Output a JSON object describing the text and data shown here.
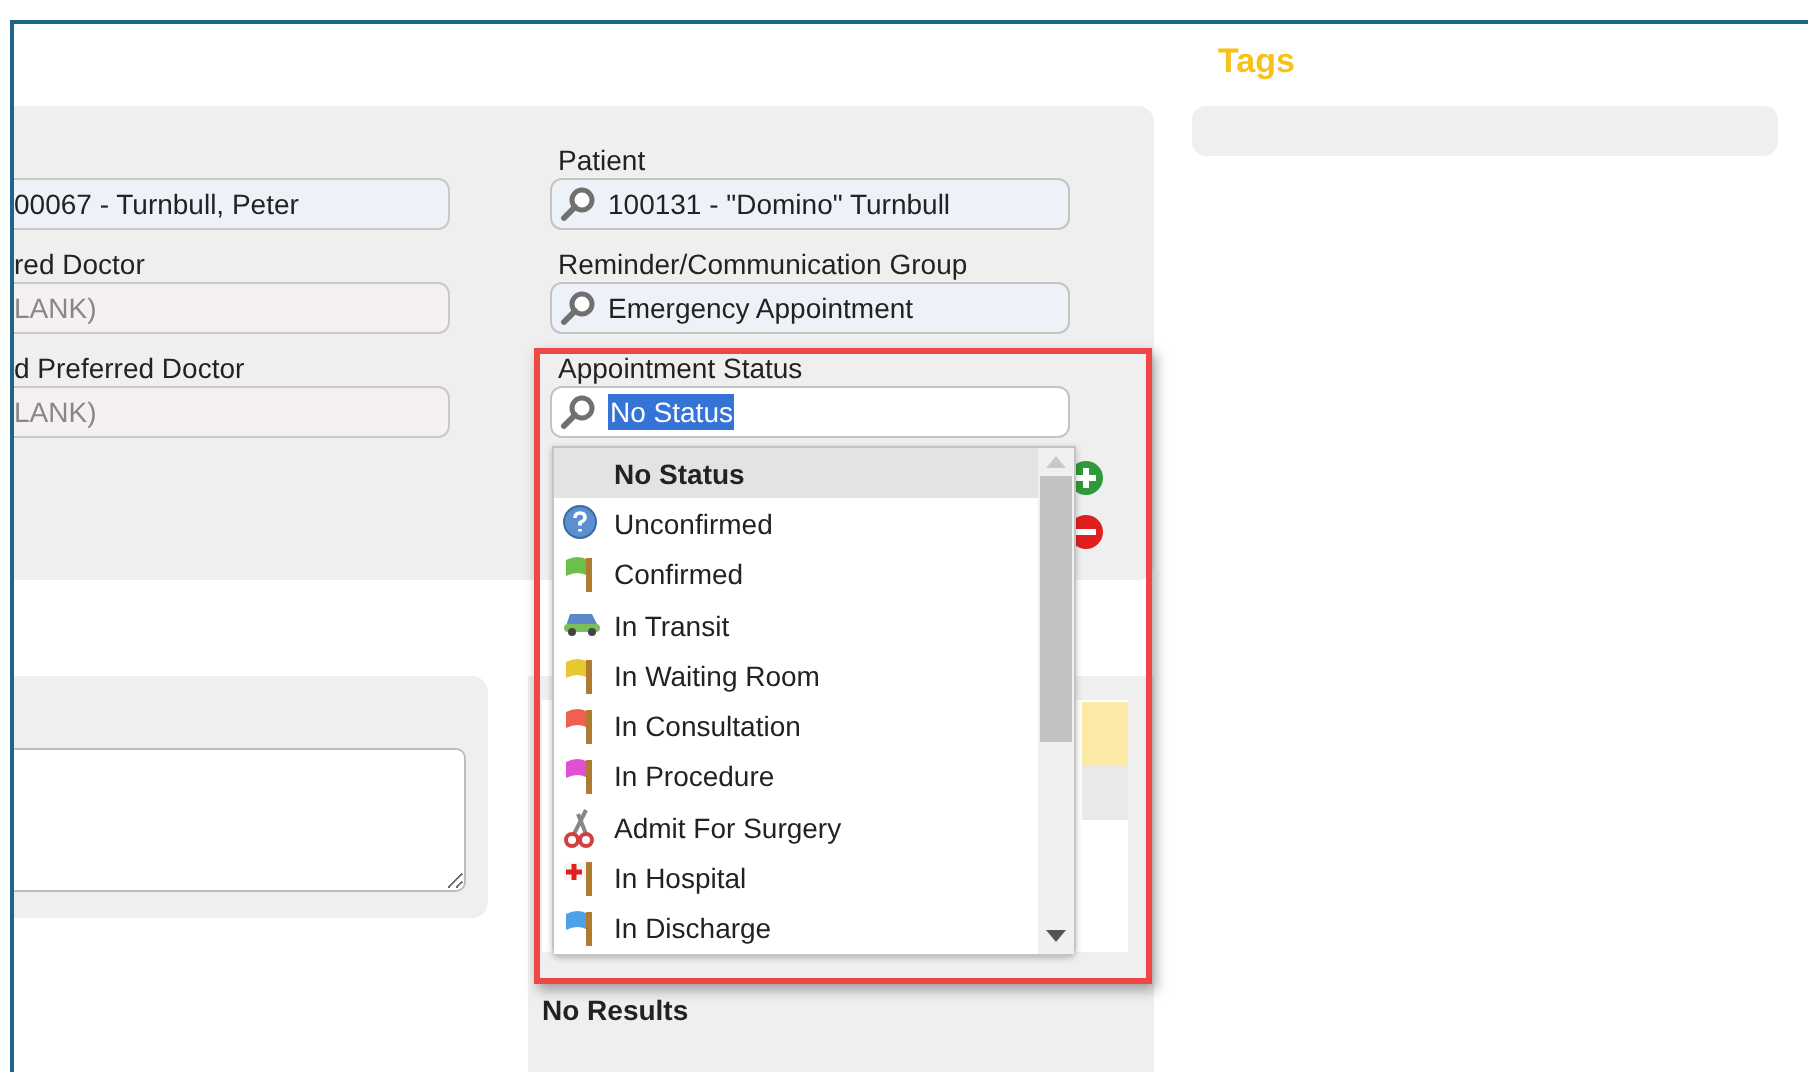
{
  "tags": {
    "title": "Tags"
  },
  "left_fields": [
    {
      "value": "00067 -  Turnbull, Peter",
      "kind": "lookup"
    },
    {
      "label": "red Doctor",
      "value": "LANK)",
      "kind": "blank"
    },
    {
      "label": "d Preferred Doctor",
      "value": "LANK)",
      "kind": "blank"
    }
  ],
  "fields": [
    {
      "label": "Patient",
      "value": "100131 - \"Domino\" Turnbull",
      "focused": false
    },
    {
      "label": "Reminder/Communication Group",
      "value": "Emergency Appointment",
      "focused": false
    },
    {
      "label": "Appointment Status",
      "value": "No Status",
      "focused": true
    }
  ],
  "status_options": [
    {
      "label": "No Status",
      "kind": "none",
      "selected": true
    },
    {
      "label": "Unconfirmed",
      "kind": "info",
      "selected": false
    },
    {
      "label": "Confirmed",
      "kind": "flag",
      "color": "#6cc04a",
      "selected": false
    },
    {
      "label": "In Transit",
      "kind": "car",
      "selected": false
    },
    {
      "label": "In Waiting Room",
      "kind": "flag",
      "color": "#e8c830",
      "selected": false
    },
    {
      "label": "In Consultation",
      "kind": "flag",
      "color": "#f06050",
      "selected": false
    },
    {
      "label": "In Procedure",
      "kind": "flag",
      "color": "#e050d0",
      "selected": false
    },
    {
      "label": "Admit For Surgery",
      "kind": "scissors",
      "selected": false
    },
    {
      "label": "In Hospital",
      "kind": "cross",
      "selected": false
    },
    {
      "label": "In Discharge",
      "kind": "flag",
      "color": "#50a0e8",
      "selected": false
    }
  ],
  "results": "No Results"
}
